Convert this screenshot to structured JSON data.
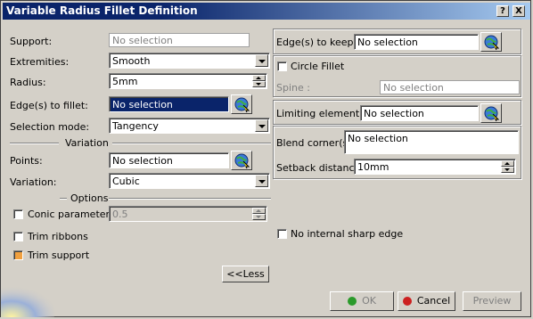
{
  "window": {
    "title": "Variable Radius Fillet Definition",
    "help_label": "?",
    "close_label": "X"
  },
  "left": {
    "support": {
      "label": "Support:",
      "value": "No selection"
    },
    "extremities": {
      "label": "Extremities:",
      "value": "Smooth"
    },
    "radius": {
      "label": "Radius:",
      "value": "5mm"
    },
    "edges_to_fillet": {
      "label": "Edge(s) to fillet:",
      "value": "No selection"
    },
    "selection_mode": {
      "label": "Selection mode:",
      "value": "Tangency"
    },
    "variation_header": "Variation",
    "points": {
      "label": "Points:",
      "value": "No selection"
    },
    "variation": {
      "label": "Variation:",
      "value": "Cubic"
    },
    "options_header": "Options",
    "conic_parameter": {
      "label": "Conic parameter:",
      "value": "0.5",
      "checked": false
    },
    "trim_ribbons": {
      "label": "Trim ribbons",
      "checked": false
    },
    "trim_support": {
      "label": "Trim support",
      "checked": true
    },
    "less_button": "<<Less"
  },
  "right": {
    "edges_to_keep": {
      "label": "Edge(s) to keep:",
      "value": "No selection"
    },
    "circle_fillet": {
      "label": "Circle Fillet",
      "checked": false
    },
    "spine": {
      "label": "Spine :",
      "value": "No selection"
    },
    "limiting_element": {
      "label": "Limiting element(s):",
      "value": "No selection"
    },
    "blend_corner": {
      "label": "Blend corner(s)",
      "value": "No selection"
    },
    "setback_distance": {
      "label": "Setback distance:",
      "value": "10mm"
    },
    "no_internal_sharp_edge": {
      "label": "No internal sharp edge",
      "checked": false
    }
  },
  "footer": {
    "ok": "OK",
    "cancel": "Cancel",
    "preview": "Preview"
  },
  "colors": {
    "title_bar": "#0a246a",
    "ok_dot": "#2a9a2a",
    "cancel_dot": "#cc2020",
    "checked_box": "#f0a040"
  }
}
